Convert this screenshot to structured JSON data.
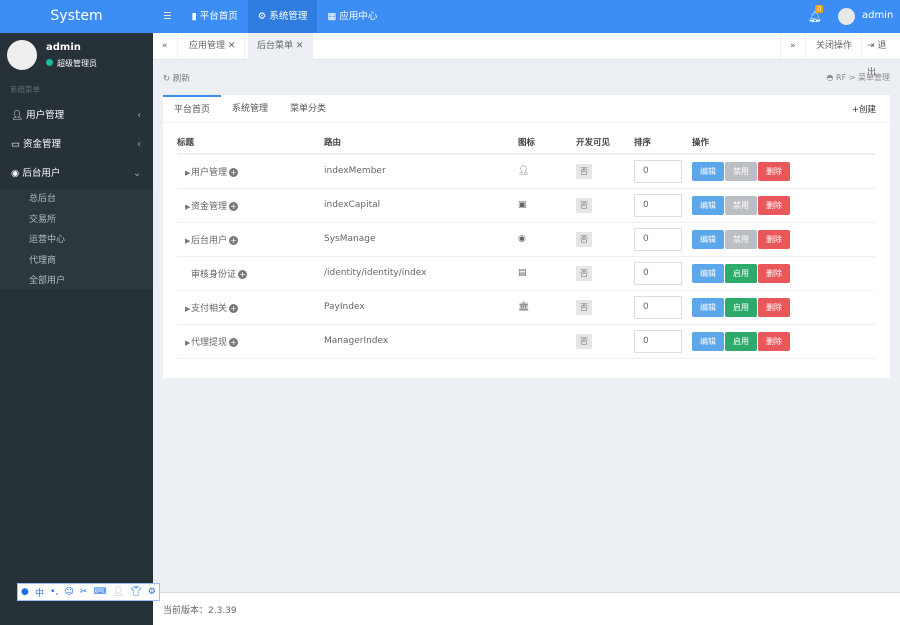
{
  "header": {
    "logo": "System",
    "nav": [
      {
        "icon": "bookmark-icon",
        "label": "平台首页"
      },
      {
        "icon": "gears-icon",
        "label": "系统管理"
      },
      {
        "icon": "grid-icon",
        "label": "应用中心"
      }
    ],
    "notifications": "0",
    "user": "admin"
  },
  "sidebar": {
    "user": "admin",
    "role": "超级管理员",
    "section": "系统菜单",
    "items": [
      {
        "icon": "user-icon",
        "label": "用户管理"
      },
      {
        "icon": "money-icon",
        "label": "资金管理"
      },
      {
        "icon": "user-circle-icon",
        "label": "后台用户"
      }
    ],
    "subitems": [
      "总后台",
      "交易所",
      "运营中心",
      "代理商",
      "全部用户"
    ]
  },
  "tabs": {
    "items": [
      "应用管理",
      "后台菜单"
    ],
    "close_ops": "关闭操作",
    "logout": "退出"
  },
  "refresh": "刷新",
  "breadcrumb": {
    "home": "RF",
    "current": "菜单管理"
  },
  "panel": {
    "tabs": [
      "平台首页",
      "系统管理",
      "菜单分类"
    ],
    "create": "创建",
    "columns": [
      "标题",
      "路由",
      "图标",
      "开发可见",
      "排序",
      "操作"
    ],
    "rows": [
      {
        "title": "用户管理",
        "route": "indexMember",
        "icon": "user-icon",
        "dev": "否",
        "sort": "0",
        "toggle": "禁用",
        "expandable": true
      },
      {
        "title": "资金管理",
        "route": "indexCapital",
        "icon": "money-icon",
        "dev": "否",
        "sort": "0",
        "toggle": "禁用",
        "expandable": true
      },
      {
        "title": "后台用户",
        "route": "SysManage",
        "icon": "user-circle-icon",
        "dev": "否",
        "sort": "0",
        "toggle": "禁用",
        "expandable": true
      },
      {
        "title": "审核身份证",
        "route": "/identity/identity/index",
        "icon": "id-card-icon",
        "dev": "否",
        "sort": "0",
        "toggle": "启用",
        "expandable": false
      },
      {
        "title": "支付相关",
        "route": "PayIndex",
        "icon": "bank-icon",
        "dev": "否",
        "sort": "0",
        "toggle": "启用",
        "expandable": true
      },
      {
        "title": "代理提现",
        "route": "ManagerIndex",
        "icon": "",
        "dev": "否",
        "sort": "0",
        "toggle": "启用",
        "expandable": true
      }
    ],
    "edit": "编辑",
    "delete": "删除"
  },
  "footer": "当前版本：2.3.39",
  "ime": {
    "lang": "中"
  }
}
